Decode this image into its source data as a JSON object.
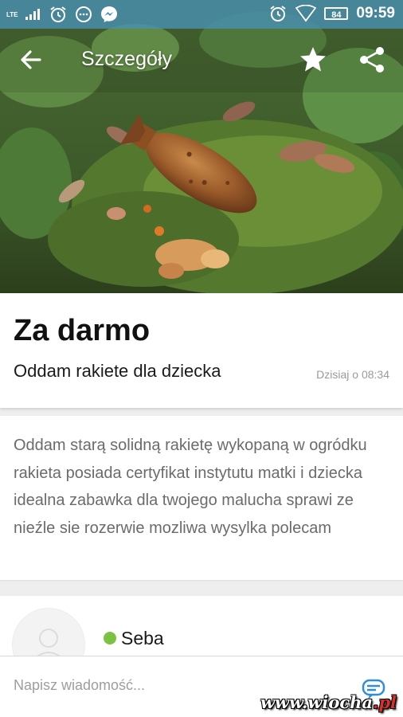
{
  "status_bar": {
    "network": "LTE",
    "battery": "84",
    "time": "09:59",
    "left_icons": [
      "signal-icon",
      "alarm-icon",
      "chat-bubble-icon",
      "messenger-icon"
    ],
    "right_icons": [
      "alarm-icon",
      "wifi-icon",
      "battery-icon"
    ]
  },
  "app_bar": {
    "title": "Szczegóły",
    "icons": [
      "back-arrow-icon",
      "star-icon",
      "share-icon"
    ]
  },
  "listing": {
    "price": "Za darmo",
    "subject": "Oddam rakiete dla dziecka",
    "date": "Dzisiaj o 08:34",
    "description": "Oddam starą solidną rakietę wykopaną w ogródku rakieta posiada certyfikat instytutu matki i dziecka idealna zabawka dla twojego malucha sprawi ze nieźle sie rozerwie mozliwa wysylka polecam"
  },
  "seller": {
    "name": "Seba",
    "status_color": "#7cc242"
  },
  "message": {
    "placeholder": "Napisz wiadomość..."
  },
  "watermark": {
    "text": "www.wiocha",
    "tld": ".pl"
  },
  "colors": {
    "status_bar": "#468caf",
    "send_icon": "#2f8fd6",
    "online": "#7cc242"
  }
}
